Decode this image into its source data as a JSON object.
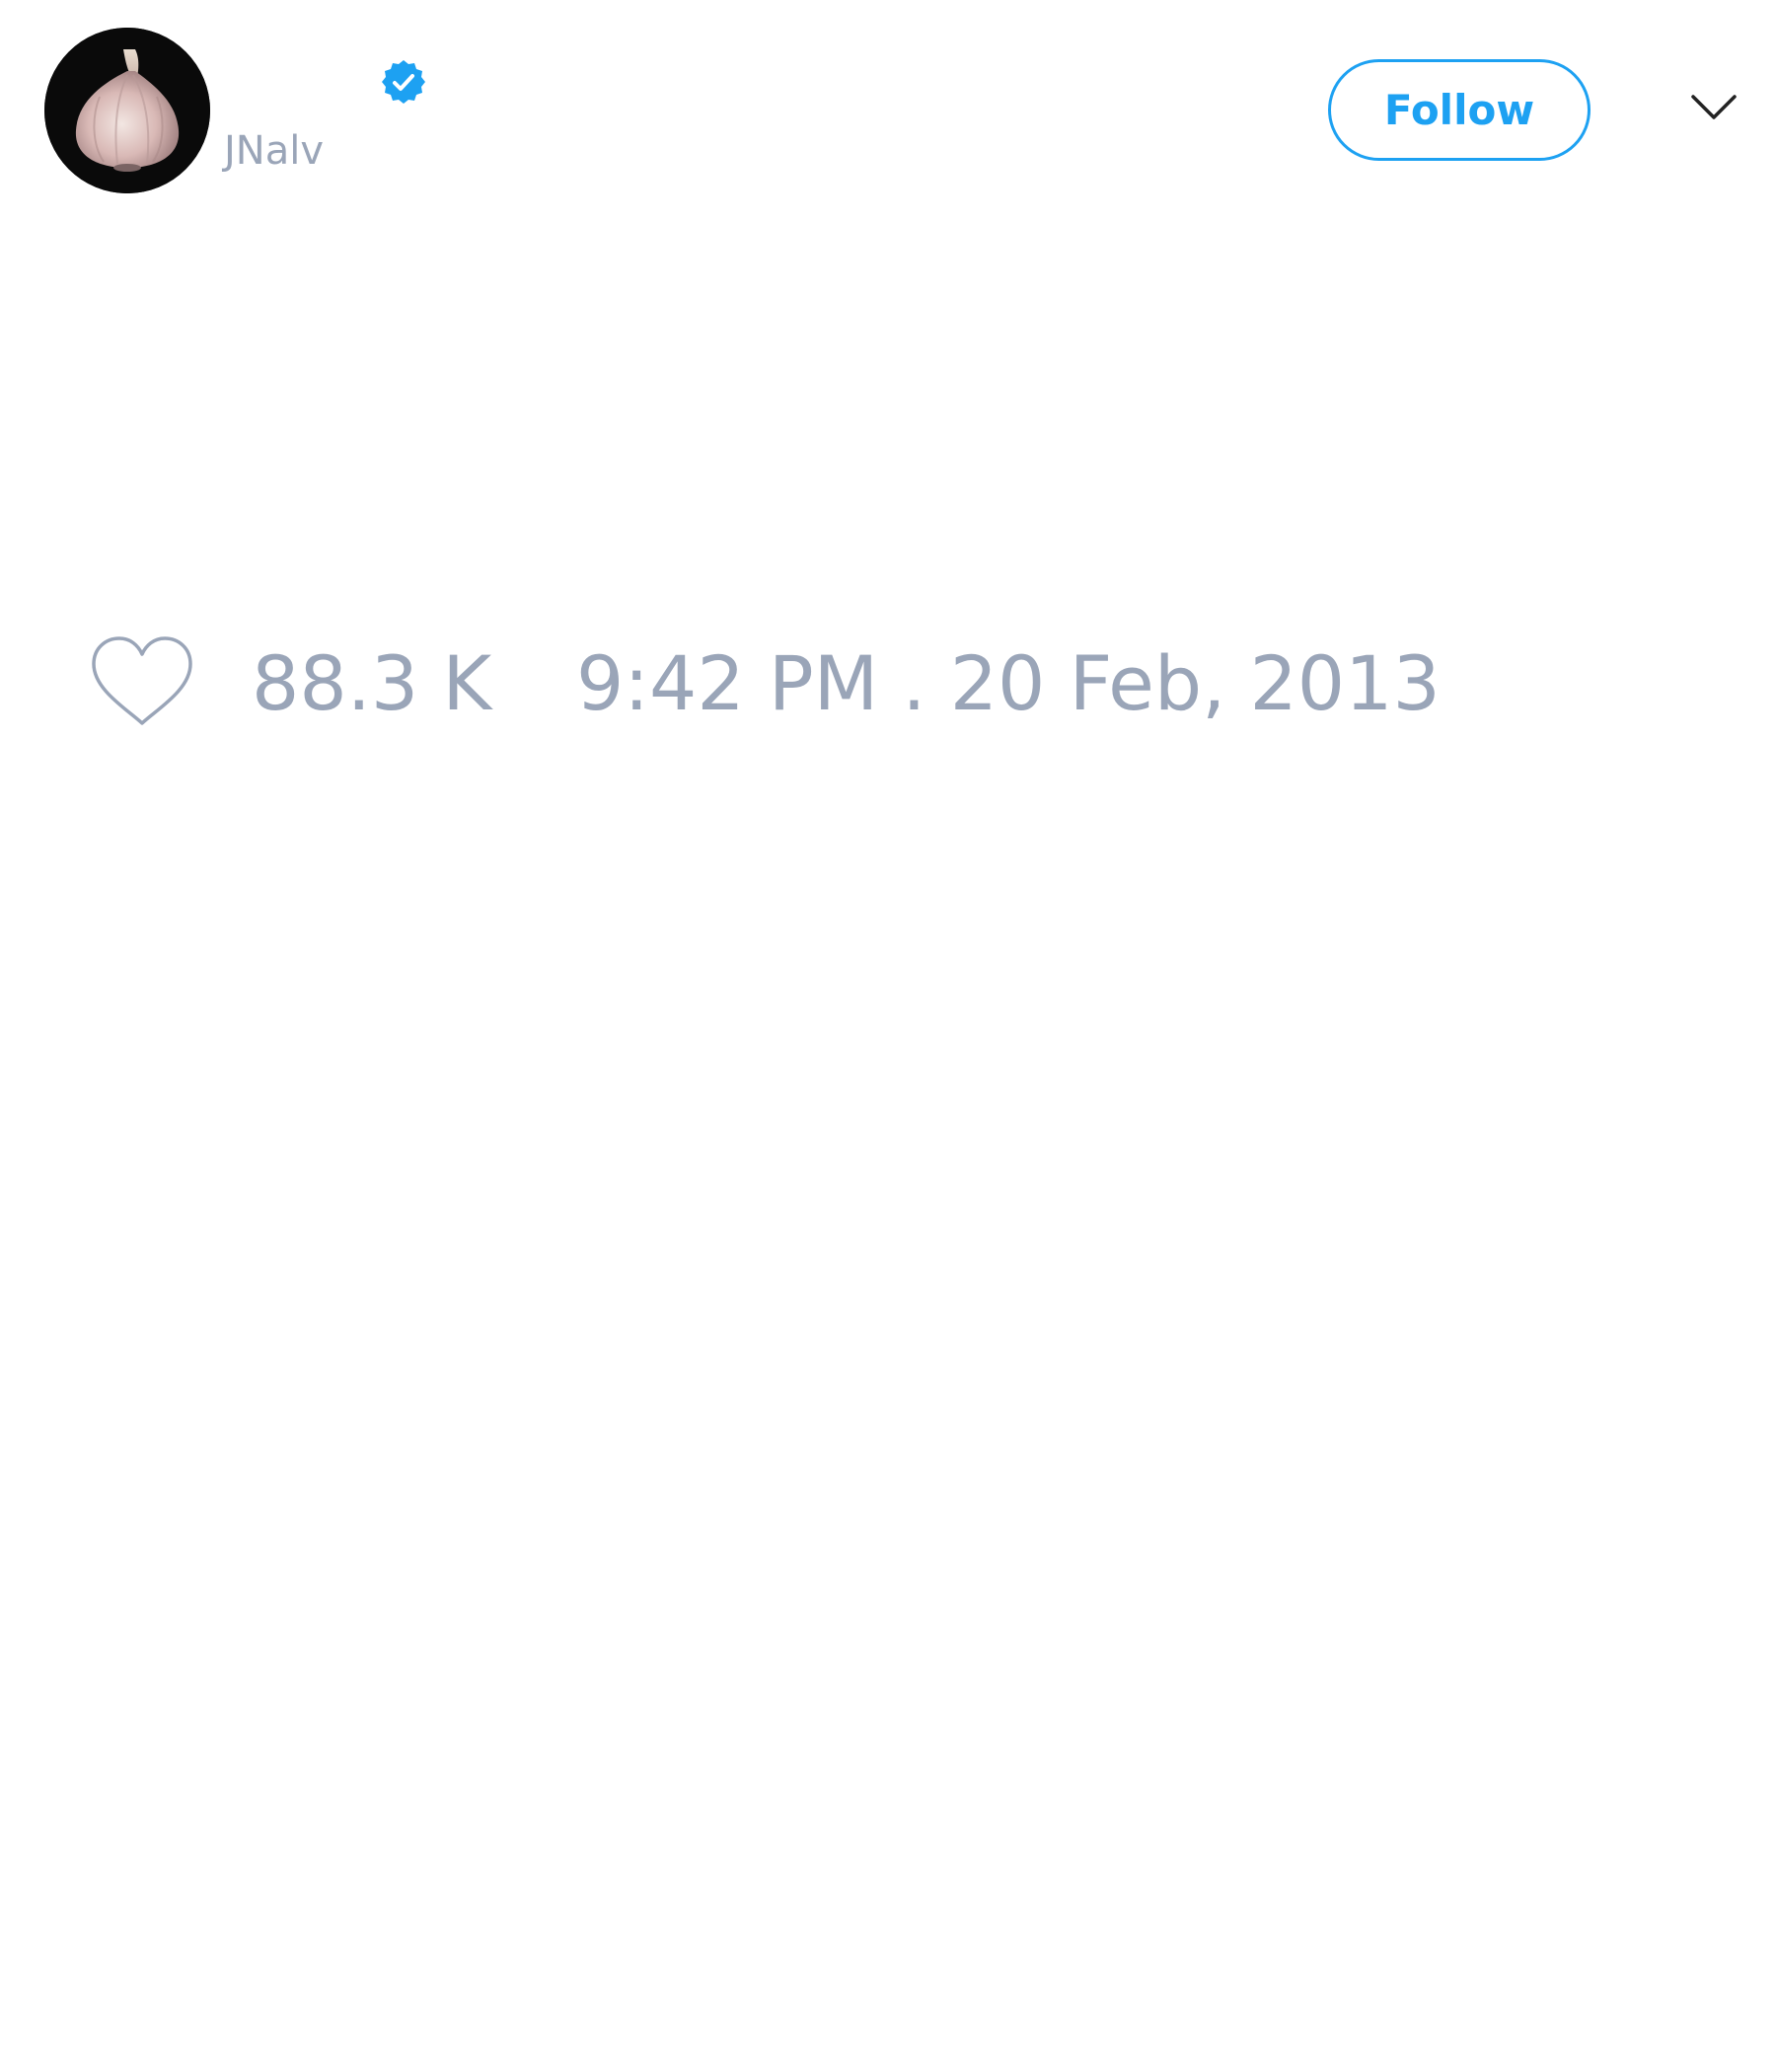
{
  "author": {
    "handle": "JNalv",
    "verified": true,
    "avatar_icon": "garlic-icon"
  },
  "header": {
    "follow_label": "Follow",
    "menu_icon": "chevron-down-icon"
  },
  "engagement": {
    "like_icon": "heart-icon",
    "like_count": "88.3 K",
    "timestamp": "9:42 PM . 20 Feb, 2013"
  },
  "colors": {
    "accent": "#1da1f2",
    "muted_text": "#9aa5b8",
    "background": "#ffffff"
  }
}
